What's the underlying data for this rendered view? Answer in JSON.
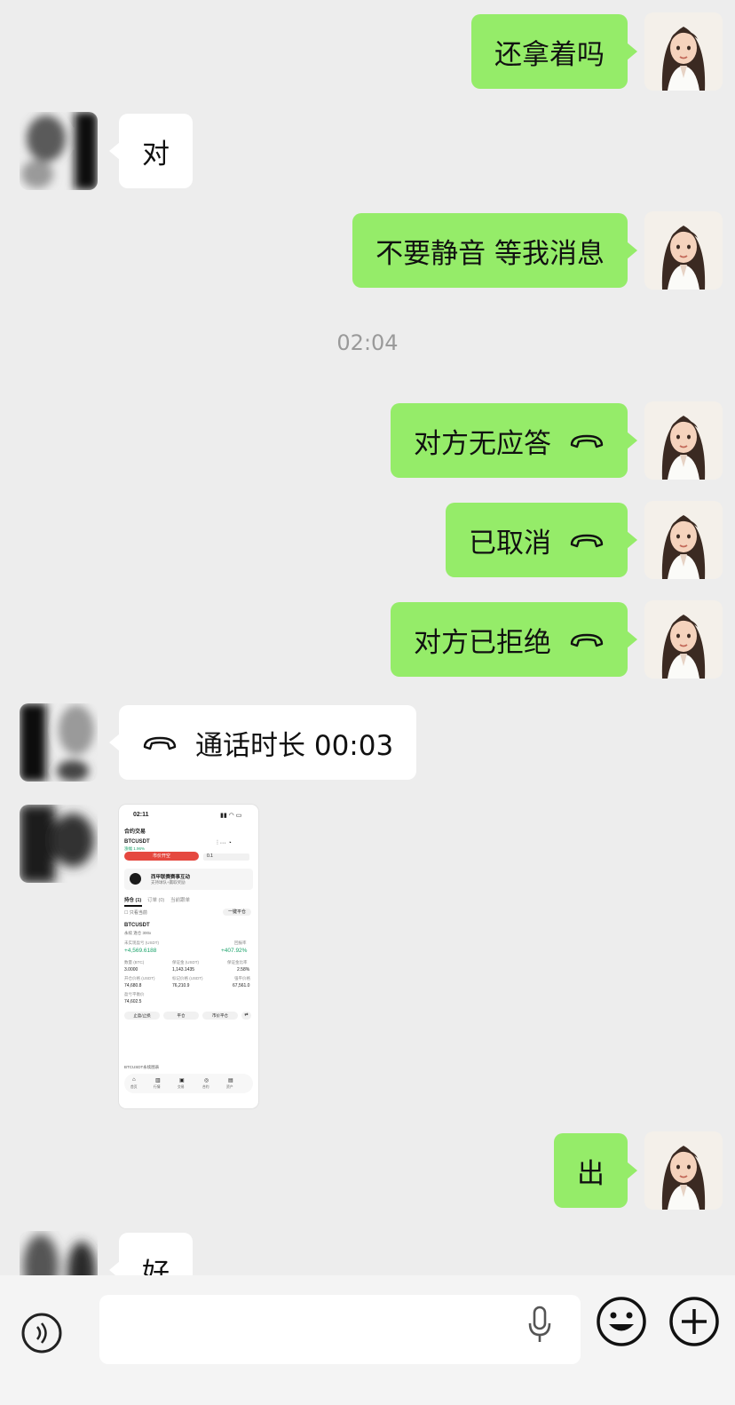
{
  "messages": {
    "m1": "还拿着吗",
    "m2": "对",
    "m3": "不要静音 等我消息",
    "m4": "对方无应答",
    "m5": "已取消",
    "m6": "对方已拒绝",
    "m7": "通话时长 00:03",
    "m8": "出",
    "m9": "好"
  },
  "timestamp": "02:04",
  "screenshot": {
    "status_time": "02:11",
    "title": "合约交易",
    "pair": "BTCUSDT",
    "pair_change": "涨幅 1.96%",
    "open_btn": "市价开空",
    "qty": "0.1",
    "promo_title": "西甲联赛赛事互动",
    "promo_sub": "支持球队+赢取奖励",
    "tabs": [
      "持仓 (1)",
      "订单 (0)",
      "当前跟单"
    ],
    "only_current": "只看当前",
    "close_all": "一键平仓",
    "pos_pair": "BTCUSDT",
    "pos_tags": "永续  逐仓  300x",
    "pnl_label": "未实现盈亏 (USDT)",
    "roe_label": "回报率",
    "pnl": "+4,569.6188",
    "roe": "+407.92%",
    "size_label": "数量 (BTC)",
    "margin_label": "保证金 (USDT)",
    "margin_ratio_label": "保证金比率",
    "size": "3.0000",
    "margin": "1,143.1435",
    "margin_ratio": "2.58%",
    "entry_label": "开仓价格 (USDT)",
    "mark_label": "标记价格 (USDT)",
    "liq_label": "强平价格",
    "entry": "74,680.8",
    "mark": "76,210.9",
    "liq": "67,561.0",
    "bep_label": "盈亏平衡价",
    "bep": "74,602.5",
    "btn1": "止盈/止损",
    "btn2": "平仓",
    "btn3": "市价平仓",
    "chart_label": "BTCUSDT永续图表",
    "nav": [
      "首页",
      "行情",
      "交易",
      "合约",
      "资产"
    ]
  }
}
